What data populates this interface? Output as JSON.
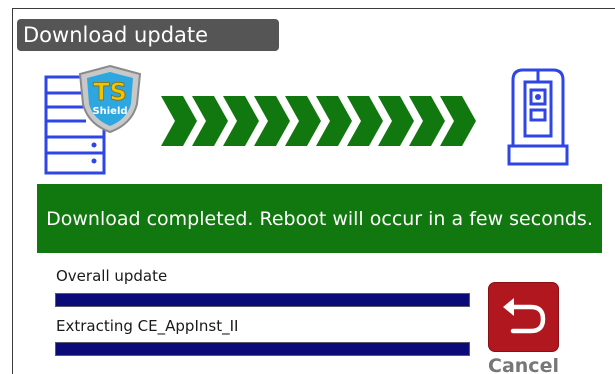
{
  "window": {
    "title": "Download update"
  },
  "graphic": {
    "logo_line1": "TS",
    "logo_line2": "Shield",
    "arrow_count": 10,
    "colors": {
      "device_blue": "#2f46e6",
      "arrow_green": "#11770f",
      "logo_cyan": "#2ea7e0",
      "logo_yellow": "#f3c300"
    }
  },
  "status": {
    "message": "Download completed. Reboot will occur in a few seconds.",
    "banner_color": "#11770f"
  },
  "progress": {
    "overall": {
      "label": "Overall update",
      "fraction": 1.0
    },
    "current": {
      "label": "Extracting CE_AppInst_II",
      "fraction": 1.0
    },
    "fill_color": "#0a0a78"
  },
  "actions": {
    "cancel": {
      "label": "Cancel",
      "icon": "back-arrow-icon",
      "color": "#b0171e"
    }
  }
}
